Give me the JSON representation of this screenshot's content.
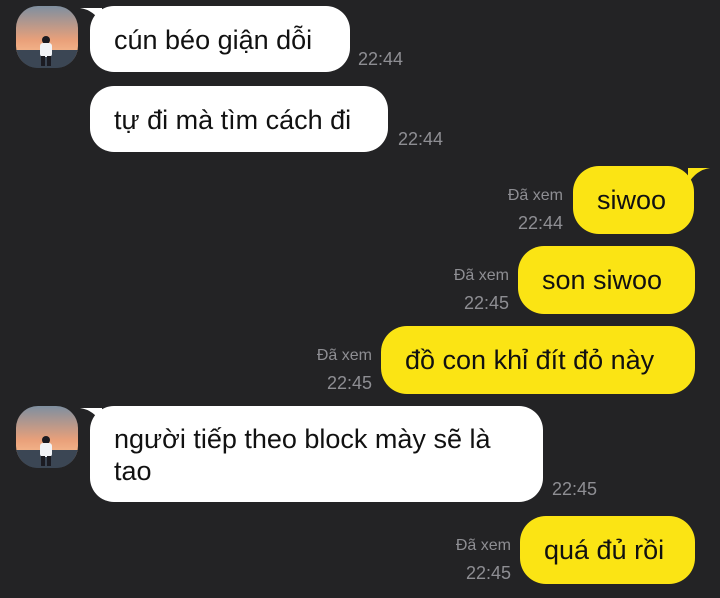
{
  "messages": [
    {
      "dir": "in",
      "text": "cún béo giận dỗi",
      "time": "22:44"
    },
    {
      "dir": "in",
      "text": "tự đi mà tìm cách đi",
      "time": "22:44"
    },
    {
      "dir": "out",
      "text": "siwoo",
      "status": "Đã xem",
      "time": "22:44"
    },
    {
      "dir": "out",
      "text": "son siwoo",
      "status": "Đã xem",
      "time": "22:45"
    },
    {
      "dir": "out",
      "text": "đồ con khỉ đít đỏ này",
      "status": "Đã xem",
      "time": "22:45"
    },
    {
      "dir": "in",
      "text": "người tiếp theo block mày sẽ là tao",
      "time": "22:45"
    },
    {
      "dir": "out",
      "text": "quá đủ rồi",
      "status": "Đã xem",
      "time": "22:45"
    }
  ],
  "colors": {
    "background": "#232325",
    "incoming": "#ffffff",
    "outgoing": "#fbe414",
    "meta": "#8e8e93"
  },
  "icons": {
    "avatar": "avatar-photo-icon"
  }
}
